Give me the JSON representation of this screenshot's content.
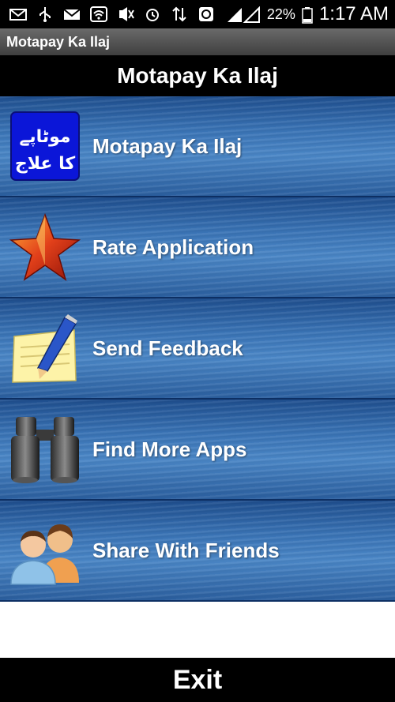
{
  "status_bar": {
    "battery_percent": "22%",
    "time": "1:17 AM",
    "icons": [
      "mail-icon",
      "usb-icon",
      "gmail-icon",
      "wifi-icon",
      "nfc-mute-icon",
      "alarm-icon",
      "data-icon",
      "sync-icon",
      "signal-icon",
      "battery-icon"
    ]
  },
  "app_bar": {
    "title": "Motapay Ka Ilaj"
  },
  "header": {
    "title": "Motapay Ka Ilaj"
  },
  "menu": {
    "items": [
      {
        "label": "Motapay Ka Ilaj",
        "icon": "urdu-logo-icon",
        "logo_text_line1": "موٹاپے",
        "logo_text_line2": "کا علاج"
      },
      {
        "label": "Rate Application",
        "icon": "star-icon"
      },
      {
        "label": "Send Feedback",
        "icon": "notepad-pencil-icon"
      },
      {
        "label": "Find More Apps",
        "icon": "binoculars-icon"
      },
      {
        "label": "Share With Friends",
        "icon": "users-icon"
      }
    ]
  },
  "footer": {
    "exit_label": "Exit"
  },
  "colors": {
    "header_bg": "#000000",
    "row_blue": "#3a74b6",
    "logo_bg": "#0b16d8",
    "text": "#ffffff"
  }
}
